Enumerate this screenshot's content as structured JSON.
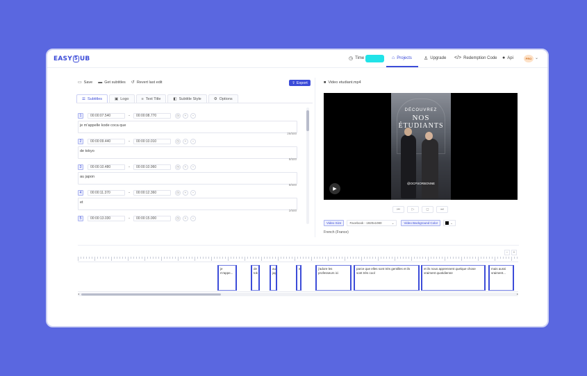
{
  "app": {
    "logo": {
      "left": "EASY",
      "s": "S",
      "right": "UB"
    },
    "nav": {
      "time_label": "Time",
      "projects": "Projects",
      "upgrade": "Upgrade",
      "redemption": "Redemption Code",
      "api": "Api",
      "avatar": "PRO"
    }
  },
  "toolbar": {
    "save": "Save",
    "get_subtitles": "Get subtitles",
    "revert": "Revert last edit",
    "export": "Export"
  },
  "tabs": [
    {
      "label": "Subtitles",
      "icon": "list-icon"
    },
    {
      "label": "Logo",
      "icon": "image-icon"
    },
    {
      "label": "Text Title",
      "icon": "text-icon"
    },
    {
      "label": "Subtitle Style",
      "icon": "style-icon"
    },
    {
      "label": "Options",
      "icon": "gear-icon"
    }
  ],
  "subtitles": [
    {
      "num": "1",
      "start": "00:00:07.540",
      "end": "00:00:08.770",
      "text": "je m'appelle kode coca que",
      "count": "26/500"
    },
    {
      "num": "2",
      "start": "00:00:09.440",
      "end": "00:00:10.010",
      "text": "de tokyo",
      "count": "8/500"
    },
    {
      "num": "3",
      "start": "00:00:10.480",
      "end": "00:00:10.960",
      "text": "au japon",
      "count": "8/500"
    },
    {
      "num": "4",
      "start": "00:00:11.370",
      "end": "00:00:12.360",
      "text": "et",
      "count": "2/500"
    },
    {
      "num": "5",
      "start": "00:00:13.030",
      "end": "00:00:15.000",
      "text": "",
      "count": ""
    }
  ],
  "preview": {
    "filename": "Video etudiant.mp4",
    "overlay_line1": "DÉCOUVREZ",
    "overlay_line2": "NOS",
    "overlay_line3": "ÉTUDIANTS",
    "handle": "@OCPSORBONNE",
    "video_size_label": "Video Size",
    "video_size_value": "Facebook - 1920x1080",
    "bg_color_label": "Video Background Color",
    "bg_color": "#000000",
    "language": "French (France)"
  },
  "timeline": {
    "segments": [
      {
        "text": "je m'appe..."
      },
      {
        "text": "de tok"
      },
      {
        "text": "au jap"
      },
      {
        "text": "et"
      },
      {
        "text": "j'adore les professeurs ici"
      },
      {
        "text": "parce que elles sont très gentilles et ils sont très cool"
      },
      {
        "text": "et ils nous apprennent quelque chose vraiment quotidienne"
      },
      {
        "text": "mais aussi vraiment..."
      }
    ]
  }
}
